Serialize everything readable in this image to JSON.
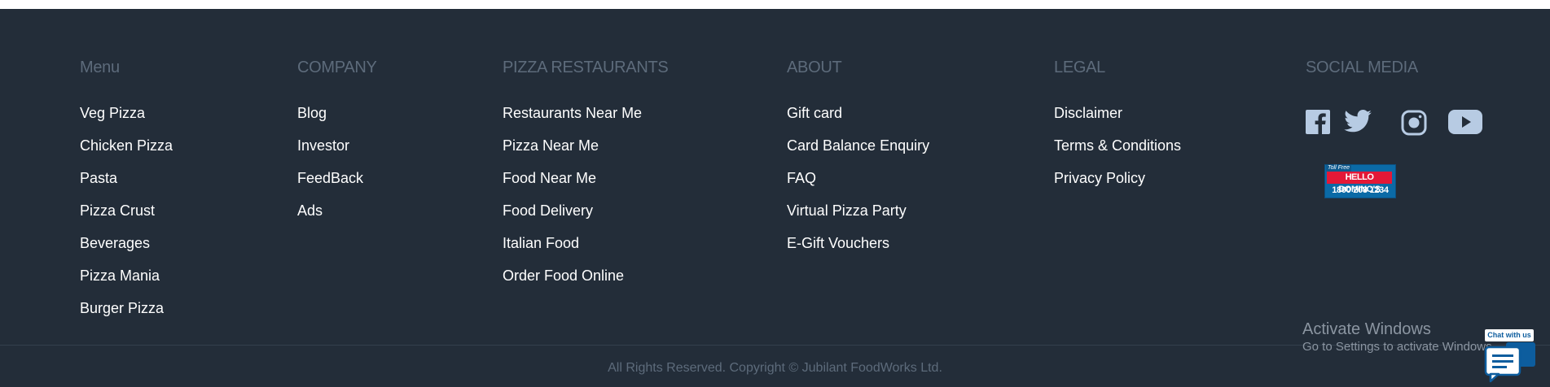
{
  "columns": [
    {
      "title": "Menu",
      "links": [
        "Veg Pizza",
        "Chicken Pizza",
        "Pasta",
        "Pizza Crust",
        "Beverages",
        "Pizza Mania",
        "Burger Pizza"
      ]
    },
    {
      "title": "COMPANY",
      "links": [
        "Blog",
        "Investor",
        "FeedBack",
        "Ads"
      ]
    },
    {
      "title": "PIZZA RESTAURANTS",
      "links": [
        "Restaurants Near Me",
        "Pizza Near Me",
        "Food Near Me",
        "Food Delivery",
        "Italian Food",
        "Order Food Online"
      ]
    },
    {
      "title": "ABOUT",
      "links": [
        "Gift card",
        "Card Balance Enquiry",
        "FAQ",
        "Virtual Pizza Party",
        "E-Gift Vouchers"
      ]
    },
    {
      "title": "LEGAL",
      "links": [
        "Disclaimer",
        "Terms & Conditions",
        "Privacy Policy"
      ]
    }
  ],
  "social": {
    "title": "SOCIAL MEDIA",
    "icons": [
      "facebook-icon",
      "twitter-icon",
      "instagram-icon",
      "youtube-icon"
    ],
    "icon_color": "#b7cbe3",
    "hello_dominos": {
      "toll": "Toll Free",
      "name": "HELLO DOMINO'S",
      "phone": "1800 208 1234"
    }
  },
  "copyright": "All Rights Reserved. Copyright © Jubilant FoodWorks Ltd.",
  "overlay": {
    "activate_title": "Activate Windows",
    "activate_sub": "Go to Settings to activate Windows.",
    "chat_label": "Chat with us"
  },
  "colors": {
    "footer_bg": "#232d39",
    "heading": "#5d6b7b",
    "link": "#ffffff",
    "chat": "#0d5d9e"
  }
}
